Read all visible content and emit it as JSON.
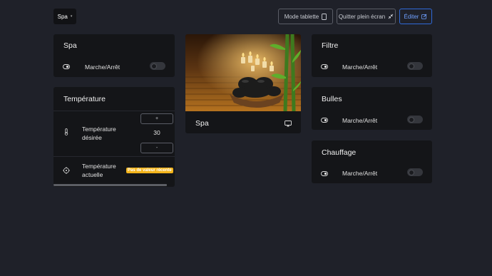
{
  "header": {
    "page_select": "Spa",
    "tablet_mode": "Mode tablette",
    "exit_fullscreen": "Quitter plein écran",
    "edit": "Éditer"
  },
  "spa_card": {
    "title": "Spa",
    "row_label": "Marche/Arrêt"
  },
  "temperature_card": {
    "title": "Température",
    "desired_label_1": "Température",
    "desired_label_2": "désirée",
    "plus": "+",
    "minus": "-",
    "desired_value": "30",
    "current_label_1": "Température",
    "current_label_2": "actuelle",
    "no_value_badge": "Pas de valeur récente"
  },
  "image_card": {
    "title": "Spa"
  },
  "filtre_card": {
    "title": "Filtre",
    "row_label": "Marche/Arrêt"
  },
  "bulles_card": {
    "title": "Bulles",
    "row_label": "Marche/Arrêt"
  },
  "chauffage_card": {
    "title": "Chauffage",
    "row_label": "Marche/Arrêt"
  },
  "colors": {
    "background": "#1f2129",
    "card": "#141518",
    "accent": "#2f6ad9",
    "warning": "#f3b41b"
  }
}
